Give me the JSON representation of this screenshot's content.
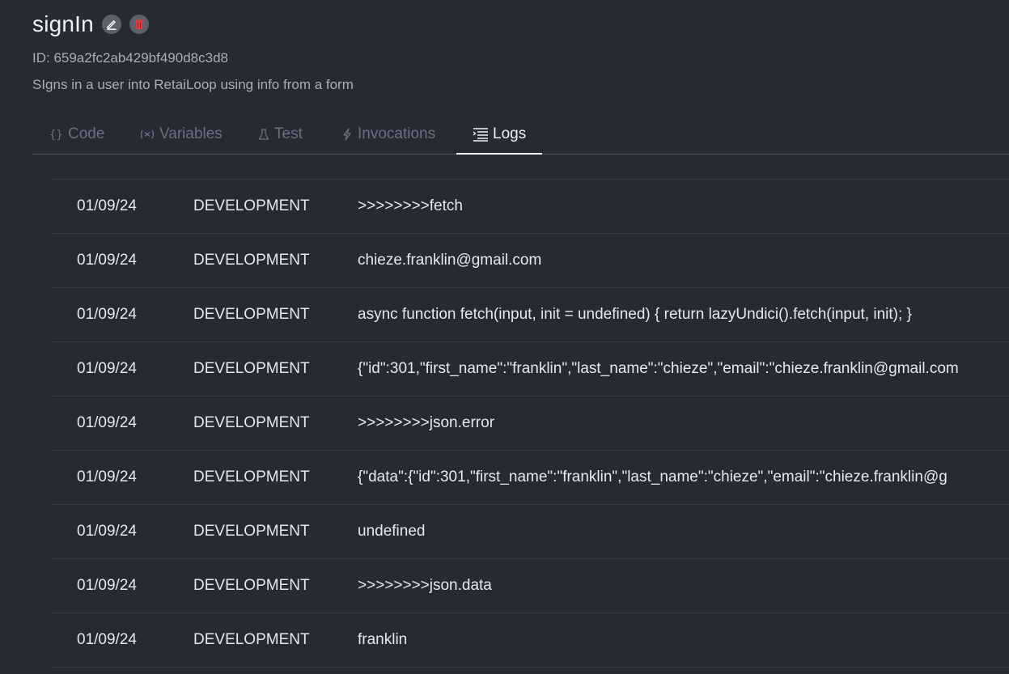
{
  "function": {
    "name": "signIn",
    "id_text": "ID: 659a2fc2ab429bf490d8c3d8",
    "description": "SIgns in a user into RetaiLoop using info from a form"
  },
  "icons": {
    "edit": "pencil-icon",
    "delete": "trash-icon"
  },
  "colors": {
    "background": "#262a35",
    "delete_accent": "#e0393e",
    "active_tab": "#f1f2f5",
    "inactive_tab": "#6b707c"
  },
  "tabs": [
    {
      "label": "Code",
      "icon": "braces-icon",
      "active": false
    },
    {
      "label": "Variables",
      "icon": "variable-icon",
      "active": false
    },
    {
      "label": "Test",
      "icon": "flask-icon",
      "active": false
    },
    {
      "label": "Invocations",
      "icon": "bolt-icon",
      "active": false
    },
    {
      "label": "Logs",
      "icon": "list-icon",
      "active": true
    }
  ],
  "logs": [
    {
      "date": "01/09/24",
      "env": "DEVELOPMENT",
      "message": ">>>>>>>>fetch"
    },
    {
      "date": "01/09/24",
      "env": "DEVELOPMENT",
      "message": "chieze.franklin@gmail.com"
    },
    {
      "date": "01/09/24",
      "env": "DEVELOPMENT",
      "message": "async function fetch(input, init = undefined) { return lazyUndici().fetch(input, init); }"
    },
    {
      "date": "01/09/24",
      "env": "DEVELOPMENT",
      "message": "{\"id\":301,\"first_name\":\"franklin\",\"last_name\":\"chieze\",\"email\":\"chieze.franklin@gmail.com"
    },
    {
      "date": "01/09/24",
      "env": "DEVELOPMENT",
      "message": ">>>>>>>>json.error"
    },
    {
      "date": "01/09/24",
      "env": "DEVELOPMENT",
      "message": "{\"data\":{\"id\":301,\"first_name\":\"franklin\",\"last_name\":\"chieze\",\"email\":\"chieze.franklin@g"
    },
    {
      "date": "01/09/24",
      "env": "DEVELOPMENT",
      "message": "undefined"
    },
    {
      "date": "01/09/24",
      "env": "DEVELOPMENT",
      "message": ">>>>>>>>json.data"
    },
    {
      "date": "01/09/24",
      "env": "DEVELOPMENT",
      "message": "franklin"
    }
  ]
}
